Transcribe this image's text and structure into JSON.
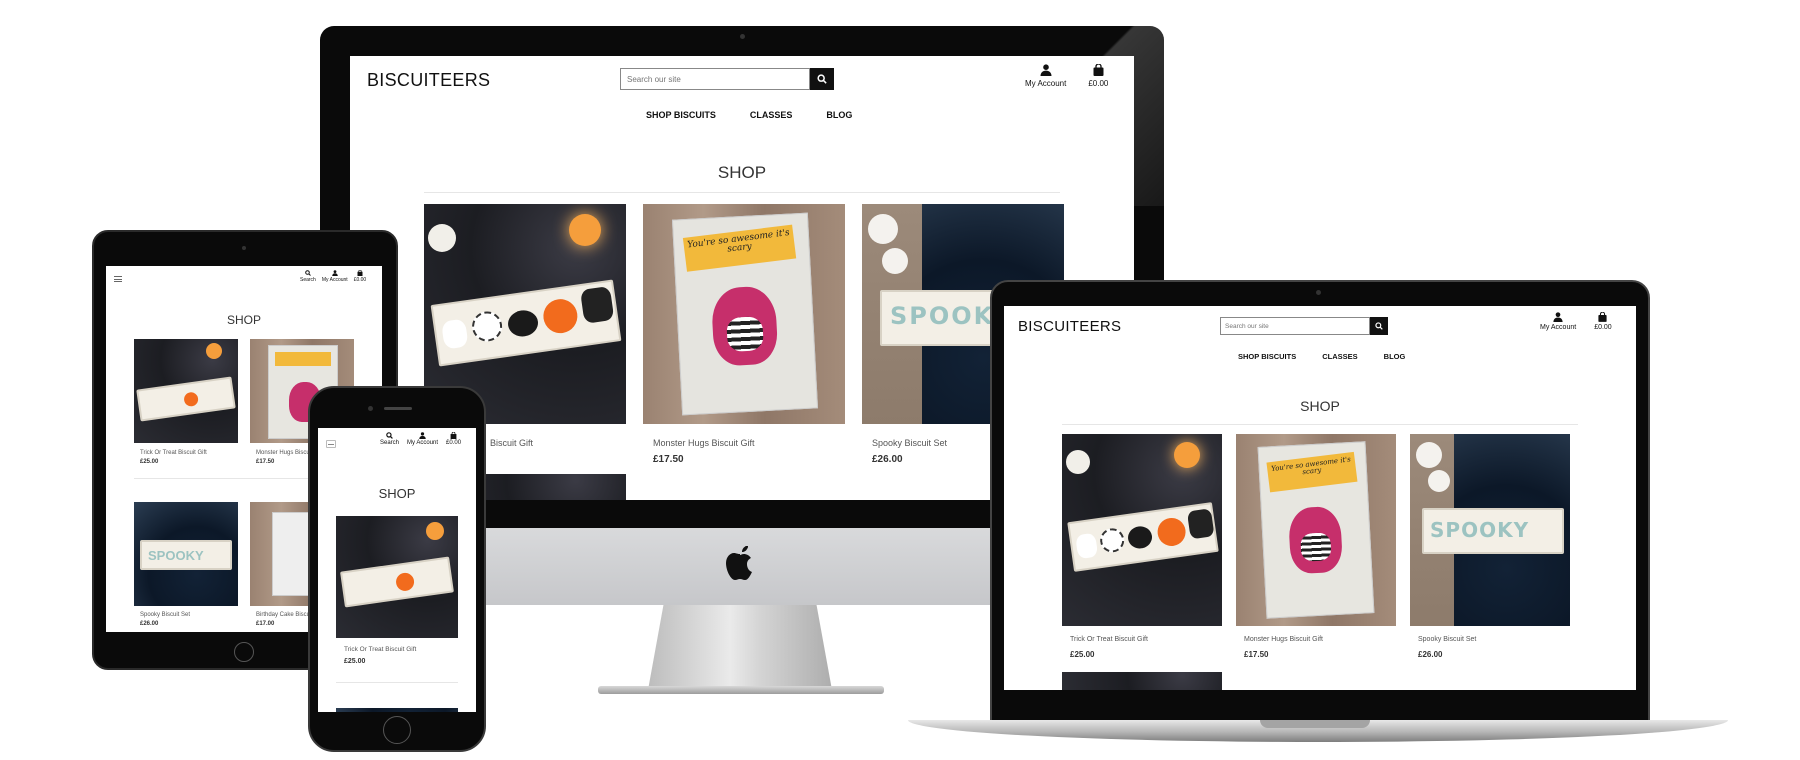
{
  "site": {
    "logo": "BISCUITEERS",
    "search_placeholder": "Search our site",
    "nav": [
      "SHOP BISCUITS",
      "CLASSES",
      "BLOG"
    ],
    "account_label": "My Account",
    "search_label": "Search",
    "cart_total": "£0.00",
    "page_title": "SHOP"
  },
  "products": [
    {
      "name": "Trick Or Treat Biscuit Gift",
      "price": "£25.00"
    },
    {
      "name": "Monster Hugs Biscuit Gift",
      "price": "£17.50"
    },
    {
      "name": "Spooky Biscuit Set",
      "price": "£26.00"
    },
    {
      "name": "Birthday Cake Biscuit Set",
      "price": "£17.00"
    }
  ],
  "desktop_partial_name": "Biscuit Gift",
  "art": {
    "plaque_text": "You're so awesome it's scary",
    "spooky_text": "SPOOKY"
  },
  "icons": {
    "search": "search-icon",
    "account": "user-icon",
    "cart": "shopping-bag-icon",
    "menu": "hamburger-icon",
    "brand": "apple-logo-icon"
  },
  "colors": {
    "bezel": "#0a0a0a",
    "accent": "#111111",
    "plaque": "#f2b93b",
    "monster": "#c62f6b",
    "pumpkin": "#f26b1d"
  }
}
